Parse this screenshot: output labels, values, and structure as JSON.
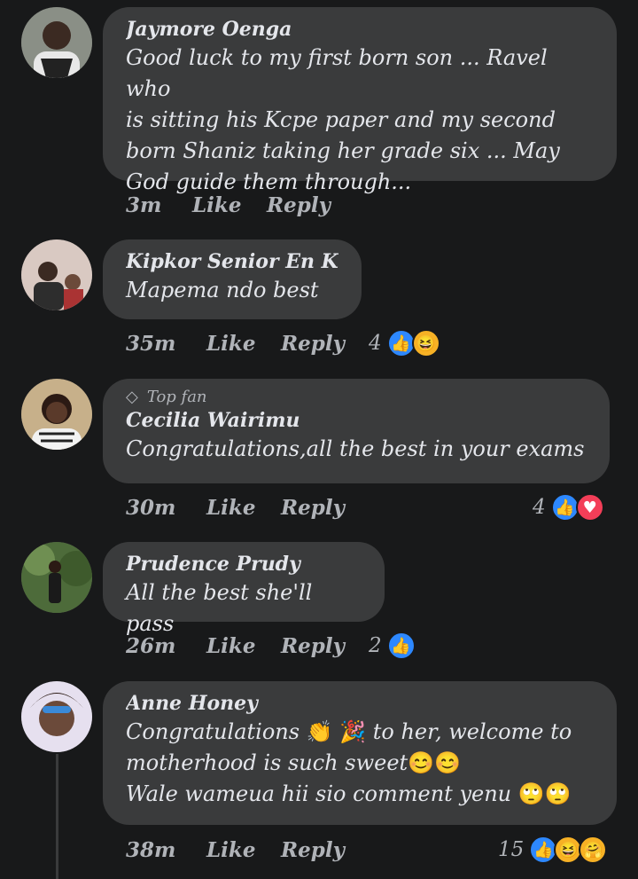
{
  "comments": [
    {
      "author": "Jaymore Oenga",
      "text_lines": [
        "Good  luck to my first born son ... Ravel who",
        "is sitting his Kcpe paper and my second",
        "born Shaniz  taking her grade six  ... May",
        "God guide them through..."
      ],
      "time": "3m",
      "like_label": "Like",
      "reply_label": "Reply",
      "reaction_count": "",
      "reactions": []
    },
    {
      "author": "Kipkor Senior En Kibibi",
      "text_lines": [
        "Mapema ndo best"
      ],
      "time": "35m",
      "like_label": "Like",
      "reply_label": "Reply",
      "reaction_count": "4",
      "reactions": [
        "like-icon",
        "haha-icon"
      ]
    },
    {
      "badge": "Top fan",
      "badge_icon": "diamond-icon",
      "author": "Cecilia Wairimu",
      "text_lines": [
        "Congratulations,all the best in your exams"
      ],
      "time": "30m",
      "like_label": "Like",
      "reply_label": "Reply",
      "reaction_count": "4",
      "reactions": [
        "like-icon",
        "love-icon"
      ]
    },
    {
      "author": "Prudence Prudy",
      "text_lines": [
        "All the best she'll pass"
      ],
      "time": "26m",
      "like_label": "Like",
      "reply_label": "Reply",
      "reaction_count": "2",
      "reactions": [
        "like-icon"
      ]
    },
    {
      "author": "Anne Honey",
      "text_line_1_a": "Congratulations",
      "text_line_1_b": "to her, welcome to",
      "text_line_2": "motherhood is such sweet",
      "text_line_3": "Wale wameua hii sio comment yenu",
      "emoji_clap": "👏",
      "emoji_party": "🎉",
      "emoji_smile": "😊😊",
      "emoji_eyeroll": "🙄🙄",
      "time": "38m",
      "like_label": "Like",
      "reply_label": "Reply",
      "reaction_count": "15",
      "reactions": [
        "like-icon",
        "haha-icon",
        "care-icon"
      ]
    }
  ],
  "colors": {
    "background": "#18191a",
    "bubble": "#3a3b3c",
    "text": "#e4e6eb",
    "muted": "#b0b3b8",
    "like_blue": "#2d88ff",
    "love_red": "#f33e58",
    "haha_yellow": "#f7b125"
  }
}
